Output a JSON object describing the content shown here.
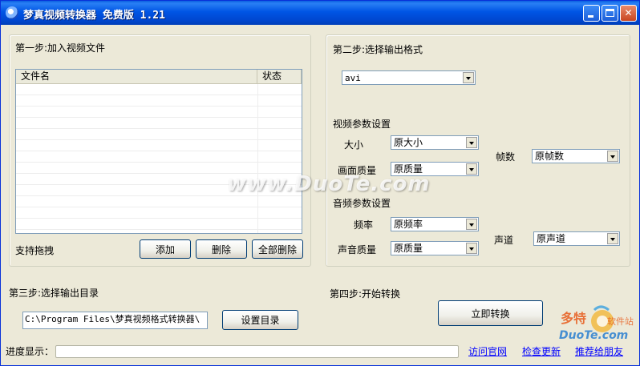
{
  "window": {
    "title": "梦真视频转换器 免费版 1.21"
  },
  "step1": {
    "title": "第一步:加入视频文件",
    "columns": [
      "文件名",
      "状态"
    ],
    "hint": "支持拖拽",
    "add_label": "添加",
    "delete_label": "删除",
    "delete_all_label": "全部删除"
  },
  "step2": {
    "title": "第二步:选择输出格式",
    "format_value": "avi",
    "video_title": "视频参数设置",
    "size_label": "大小",
    "size_value": "原大小",
    "quality_label": "画面质量",
    "quality_value": "原质量",
    "fps_label": "帧数",
    "fps_value": "原帧数",
    "audio_title": "音频参数设置",
    "rate_label": "频率",
    "rate_value": "原频率",
    "audio_quality_label": "声音质量",
    "audio_quality_value": "原质量",
    "channel_label": "声道",
    "channel_value": "原声道"
  },
  "step3": {
    "title": "第三步:选择输出目录",
    "path_value": "C:\\Program Files\\梦真视频格式转换器\\",
    "set_dir_label": "设置目录"
  },
  "step4": {
    "title": "第四步:开始转换",
    "convert_label": "立即转换"
  },
  "footer": {
    "progress_label": "进度显示：",
    "progress": 0,
    "visit_label": "访问官网",
    "update_label": "检查更新",
    "recommend_label": "推荐给朋友"
  },
  "watermark": {
    "text": "www.DuoTe.com"
  },
  "logo": {
    "text_top": "多特",
    "text_mid": "软件站",
    "text_en": "DuoTe.com"
  },
  "colors": {
    "title_bar": "#0055e5",
    "window_bg": "#ece9d8",
    "link": "#0000ff",
    "close_button": "#c94520"
  },
  "icons": [
    "app-icon",
    "minimize-icon",
    "maximize-icon",
    "close-icon",
    "dropdown-arrow-icon"
  ]
}
